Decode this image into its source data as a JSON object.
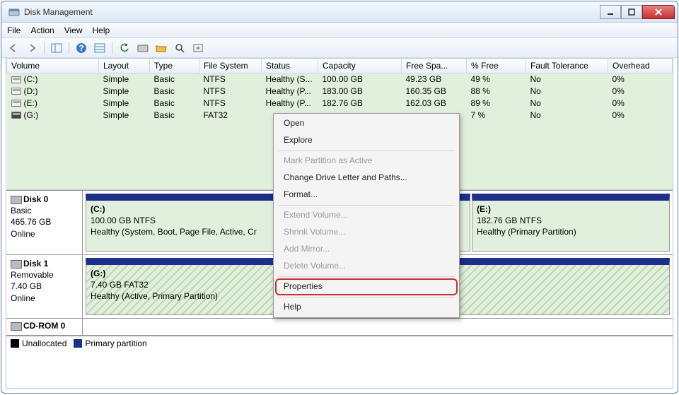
{
  "window": {
    "title": "Disk Management"
  },
  "menu": {
    "file": "File",
    "action": "Action",
    "view": "View",
    "help": "Help"
  },
  "columns": {
    "volume": "Volume",
    "layout": "Layout",
    "type": "Type",
    "fs": "File System",
    "status": "Status",
    "capacity": "Capacity",
    "free": "Free Spa...",
    "pfree": "% Free",
    "fault": "Fault Tolerance",
    "overhead": "Overhead"
  },
  "vols": [
    {
      "name": "(C:)",
      "layout": "Simple",
      "type": "Basic",
      "fs": "NTFS",
      "status": "Healthy (S...",
      "cap": "100.00 GB",
      "free": "49.23 GB",
      "pfree": "49 %",
      "fault": "No",
      "ov": "0%",
      "dark": false
    },
    {
      "name": "(D:)",
      "layout": "Simple",
      "type": "Basic",
      "fs": "NTFS",
      "status": "Healthy (P...",
      "cap": "183.00 GB",
      "free": "160.35 GB",
      "pfree": "88 %",
      "fault": "No",
      "ov": "0%",
      "dark": false
    },
    {
      "name": "(E:)",
      "layout": "Simple",
      "type": "Basic",
      "fs": "NTFS",
      "status": "Healthy (P...",
      "cap": "182.76 GB",
      "free": "162.03 GB",
      "pfree": "89 %",
      "fault": "No",
      "ov": "0%",
      "dark": false
    },
    {
      "name": "(G:)",
      "layout": "Simple",
      "type": "Basic",
      "fs": "FAT32",
      "status": "",
      "cap": "",
      "free": "",
      "pfree": "7 %",
      "fault": "No",
      "ov": "0%",
      "dark": true
    }
  ],
  "disks": {
    "d0": {
      "title": "Disk 0",
      "type": "Basic",
      "size": "465.76 GB",
      "state": "Online"
    },
    "d1": {
      "title": "Disk 1",
      "type": "Removable",
      "size": "7.40 GB",
      "state": "Online"
    },
    "cd": {
      "title": "CD-ROM 0"
    }
  },
  "parts": {
    "c": {
      "label": "(C:)",
      "info": "100.00 GB NTFS",
      "status": "Healthy (System, Boot, Page File, Active, Cr"
    },
    "e": {
      "label": "(E:)",
      "info": "182.76 GB NTFS",
      "status": "Healthy (Primary Partition)"
    },
    "g": {
      "label": "(G:)",
      "info": "7.40 GB FAT32",
      "status": "Healthy (Active, Primary Partition)"
    }
  },
  "legend": {
    "unalloc": "Unallocated",
    "primary": "Primary partition"
  },
  "ctx": {
    "open": "Open",
    "explore": "Explore",
    "mark": "Mark Partition as Active",
    "change": "Change Drive Letter and Paths...",
    "format": "Format...",
    "extend": "Extend Volume...",
    "shrink": "Shrink Volume...",
    "mirror": "Add Mirror...",
    "delete": "Delete Volume...",
    "properties": "Properties",
    "help": "Help"
  }
}
